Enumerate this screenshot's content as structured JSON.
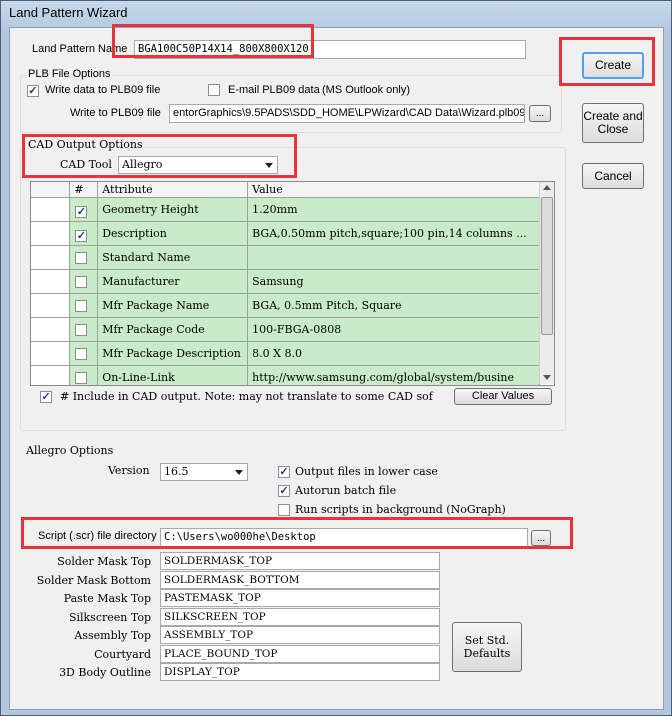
{
  "window": {
    "title": "Land Pattern Wizard"
  },
  "land_pattern": {
    "label": "Land Pattern Name",
    "value": "BGA100C50P14X14_800X800X120"
  },
  "plb_options": {
    "group_label": "PLB File Options",
    "write_data_label": "Write data to PLB09 file",
    "email_label": "E-mail PLB09 data",
    "email_note": "(MS Outlook only)",
    "write_to_label": "Write to PLB09 file",
    "write_to_value": "entorGraphics\\9.5PADS\\SDD_HOME\\LPWizard\\CAD Data\\Wizard.plb09",
    "browse_label": "..."
  },
  "buttons": {
    "create": "Create",
    "create_close": "Create and Close",
    "cancel": "Cancel"
  },
  "cad_output": {
    "group_label": "CAD Output Options",
    "cad_tool_label": "CAD Tool",
    "cad_tool_value": "Allegro",
    "columns": [
      "#",
      "Attribute",
      "Value"
    ],
    "rows": [
      {
        "checked": true,
        "attribute": "Geometry Height",
        "value": "1.20mm"
      },
      {
        "checked": true,
        "attribute": "Description",
        "value": "BGA,0.50mm pitch,square;100 pin,14 columns ..."
      },
      {
        "checked": false,
        "attribute": "Standard Name",
        "value": ""
      },
      {
        "checked": false,
        "attribute": "Manufacturer",
        "value": "Samsung"
      },
      {
        "checked": false,
        "attribute": "Mfr Package Name",
        "value": "BGA, 0.5mm Pitch, Square"
      },
      {
        "checked": false,
        "attribute": "Mfr Package Code",
        "value": "100-FBGA-0808"
      },
      {
        "checked": false,
        "attribute": "Mfr Package Description",
        "value": "8.0 X 8.0"
      },
      {
        "checked": false,
        "attribute": "On-Line-Link",
        "value": "http://www.samsung.com/global/system/busine"
      }
    ],
    "include_note": "# Include in CAD output.  Note: may not translate to some CAD sof",
    "clear_values_label": "Clear Values"
  },
  "allegro": {
    "group_label": "Allegro Options",
    "version_label": "Version",
    "version_value": "16.5",
    "output_lower_label": "Output files in lower case",
    "autorun_label": "Autorun batch file",
    "run_bg_label": "Run scripts in background (NoGraph)",
    "script_dir_label": "Script (.scr) file directory",
    "script_dir_value": "C:\\Users\\wo000he\\Desktop",
    "layers": [
      {
        "label": "Solder Mask Top",
        "value": "SOLDERMASK_TOP"
      },
      {
        "label": "Solder Mask Bottom",
        "value": "SOLDERMASK_BOTTOM"
      },
      {
        "label": "Paste Mask Top",
        "value": "PASTEMASK_TOP"
      },
      {
        "label": "Silkscreen Top",
        "value": "SILKSCREEN_TOP"
      },
      {
        "label": "Assembly Top",
        "value": "ASSEMBLY_TOP"
      },
      {
        "label": "Courtyard",
        "value": "PLACE_BOUND_TOP"
      },
      {
        "label": "3D Body Outline",
        "value": "DISPLAY_TOP"
      }
    ],
    "set_defaults_label": "Set Std. Defaults"
  }
}
